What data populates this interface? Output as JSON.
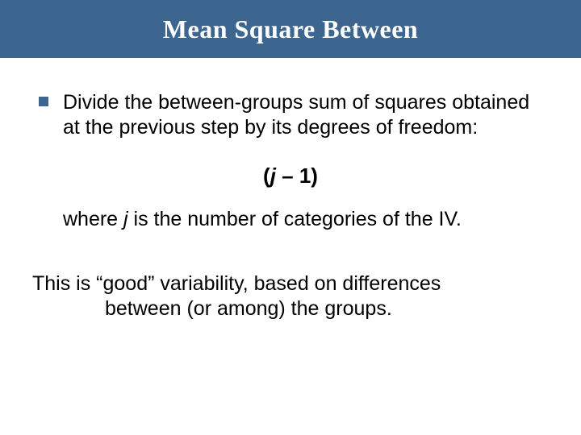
{
  "title": "Mean Square Between",
  "bullet": "Divide the between-groups sum of squares obtained at the previous step by its degrees of freedom:",
  "formula": {
    "open": "(",
    "var": "j",
    "mid": " – 1)",
    "full_plain": "(j – 1)"
  },
  "where": {
    "prefix": "where ",
    "var": "j",
    "suffix": " is the number of categories of the IV."
  },
  "good": {
    "line1": "This is “good” variability, based on differences",
    "line2": "between (or among) the groups."
  }
}
